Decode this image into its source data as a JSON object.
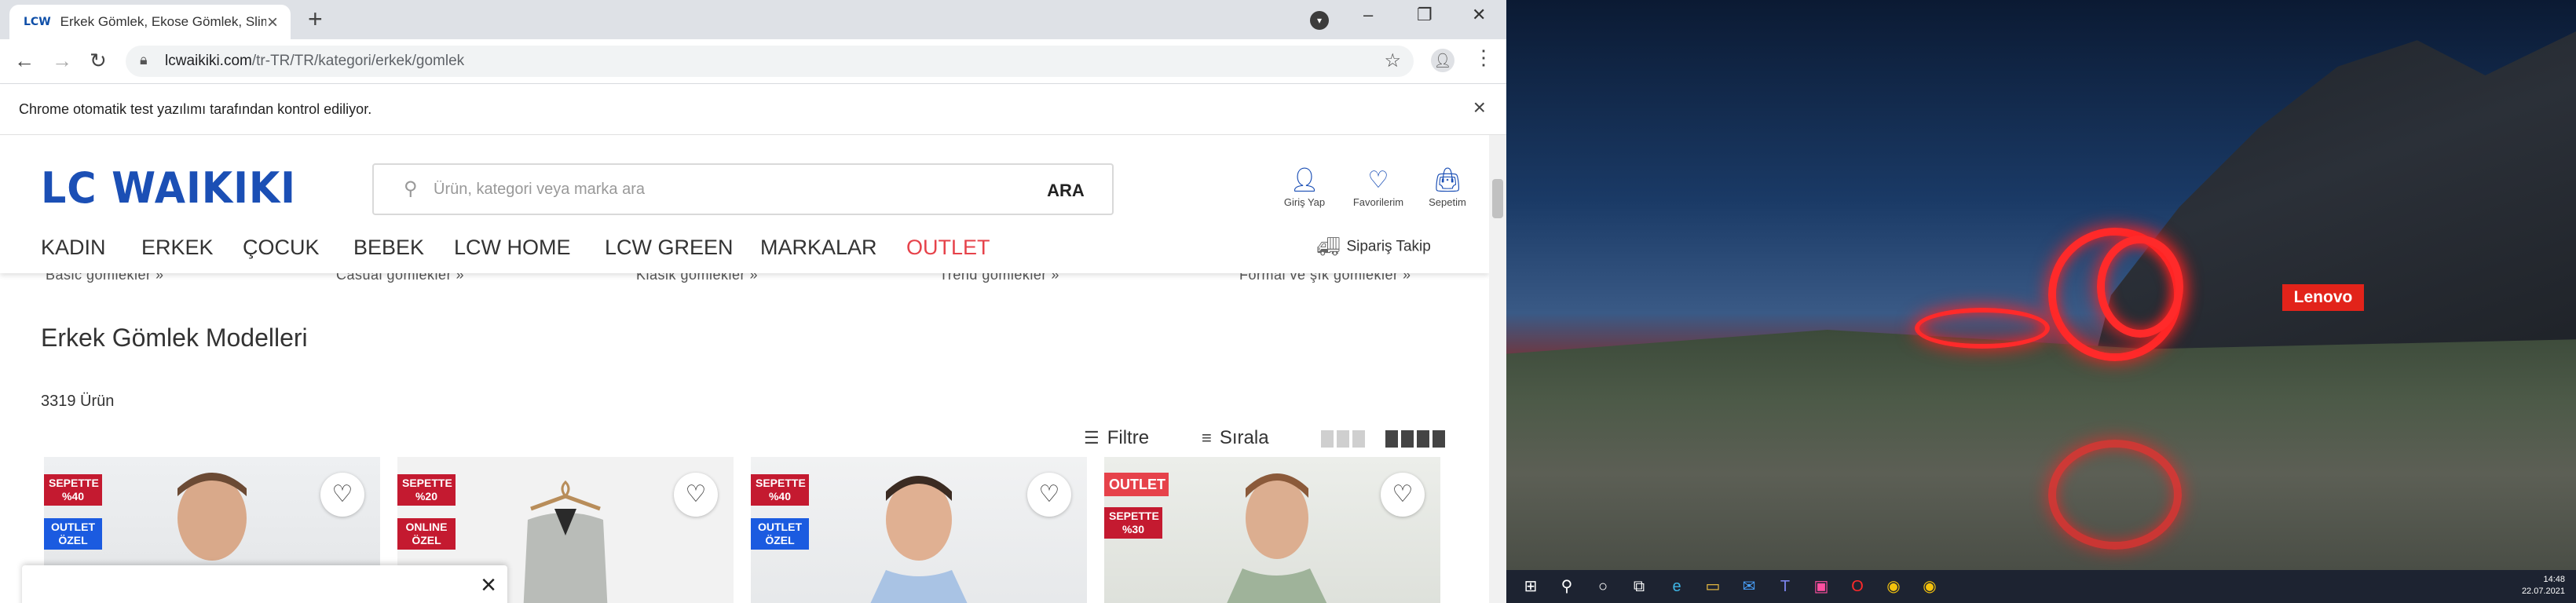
{
  "browser": {
    "tab_title": "Erkek Gömlek, Ekose Gömlek, Slim",
    "tab_favicon": "LCW",
    "url_host": "lcwaikiki.com",
    "url_path": "/tr-TR/TR/kategori/erkek/gomlek",
    "infobar_message": "Chrome otomatik test yazılımı tarafından kontrol ediliyor."
  },
  "site": {
    "logo": "LC WAIKIKI",
    "search_placeholder": "Ürün, kategori veya marka ara",
    "search_button": "ARA",
    "header_icons": [
      {
        "label": "Giriş Yap",
        "icon": "user-icon"
      },
      {
        "label": "Favorilerim",
        "icon": "heart-icon"
      },
      {
        "label": "Sepetim",
        "icon": "bag-icon"
      }
    ],
    "nav": [
      "KADIN",
      "ERKEK",
      "ÇOCUK",
      "BEBEK",
      "LCW HOME",
      "LCW GREEN",
      "MARKALAR",
      "OUTLET"
    ],
    "order_tracking": "Sipariş Takip",
    "subcategories": [
      "Basic gömlekler »",
      "Casual gömlekler »",
      "Klasik gömlekler »",
      "Trend gömlekler »",
      "Formal ve şık gömlekler »"
    ],
    "page_title": "Erkek Gömlek Modelleri",
    "product_count": "3319 Ürün",
    "filter_label": "Filtre",
    "sort_label": "Sırala",
    "products": [
      {
        "badges": [
          "SEPETTE %40",
          "OUTLET ÖZEL"
        ]
      },
      {
        "badges": [
          "SEPETTE %20",
          "ONLINE ÖZEL"
        ]
      },
      {
        "badges": [
          "SEPETTE %40",
          "OUTLET ÖZEL"
        ]
      },
      {
        "badges": [
          "OUTLET",
          "SEPETTE %30"
        ]
      }
    ]
  },
  "desktop": {
    "wallpaper_brand": "Lenovo",
    "clock_time": "14:48",
    "clock_date": "22.07.2021"
  },
  "colors": {
    "brand_blue": "#1b4fb5",
    "outlet_red": "#e6424a",
    "badge_red": "#c41a30",
    "badge_blue": "#1b5be0"
  }
}
